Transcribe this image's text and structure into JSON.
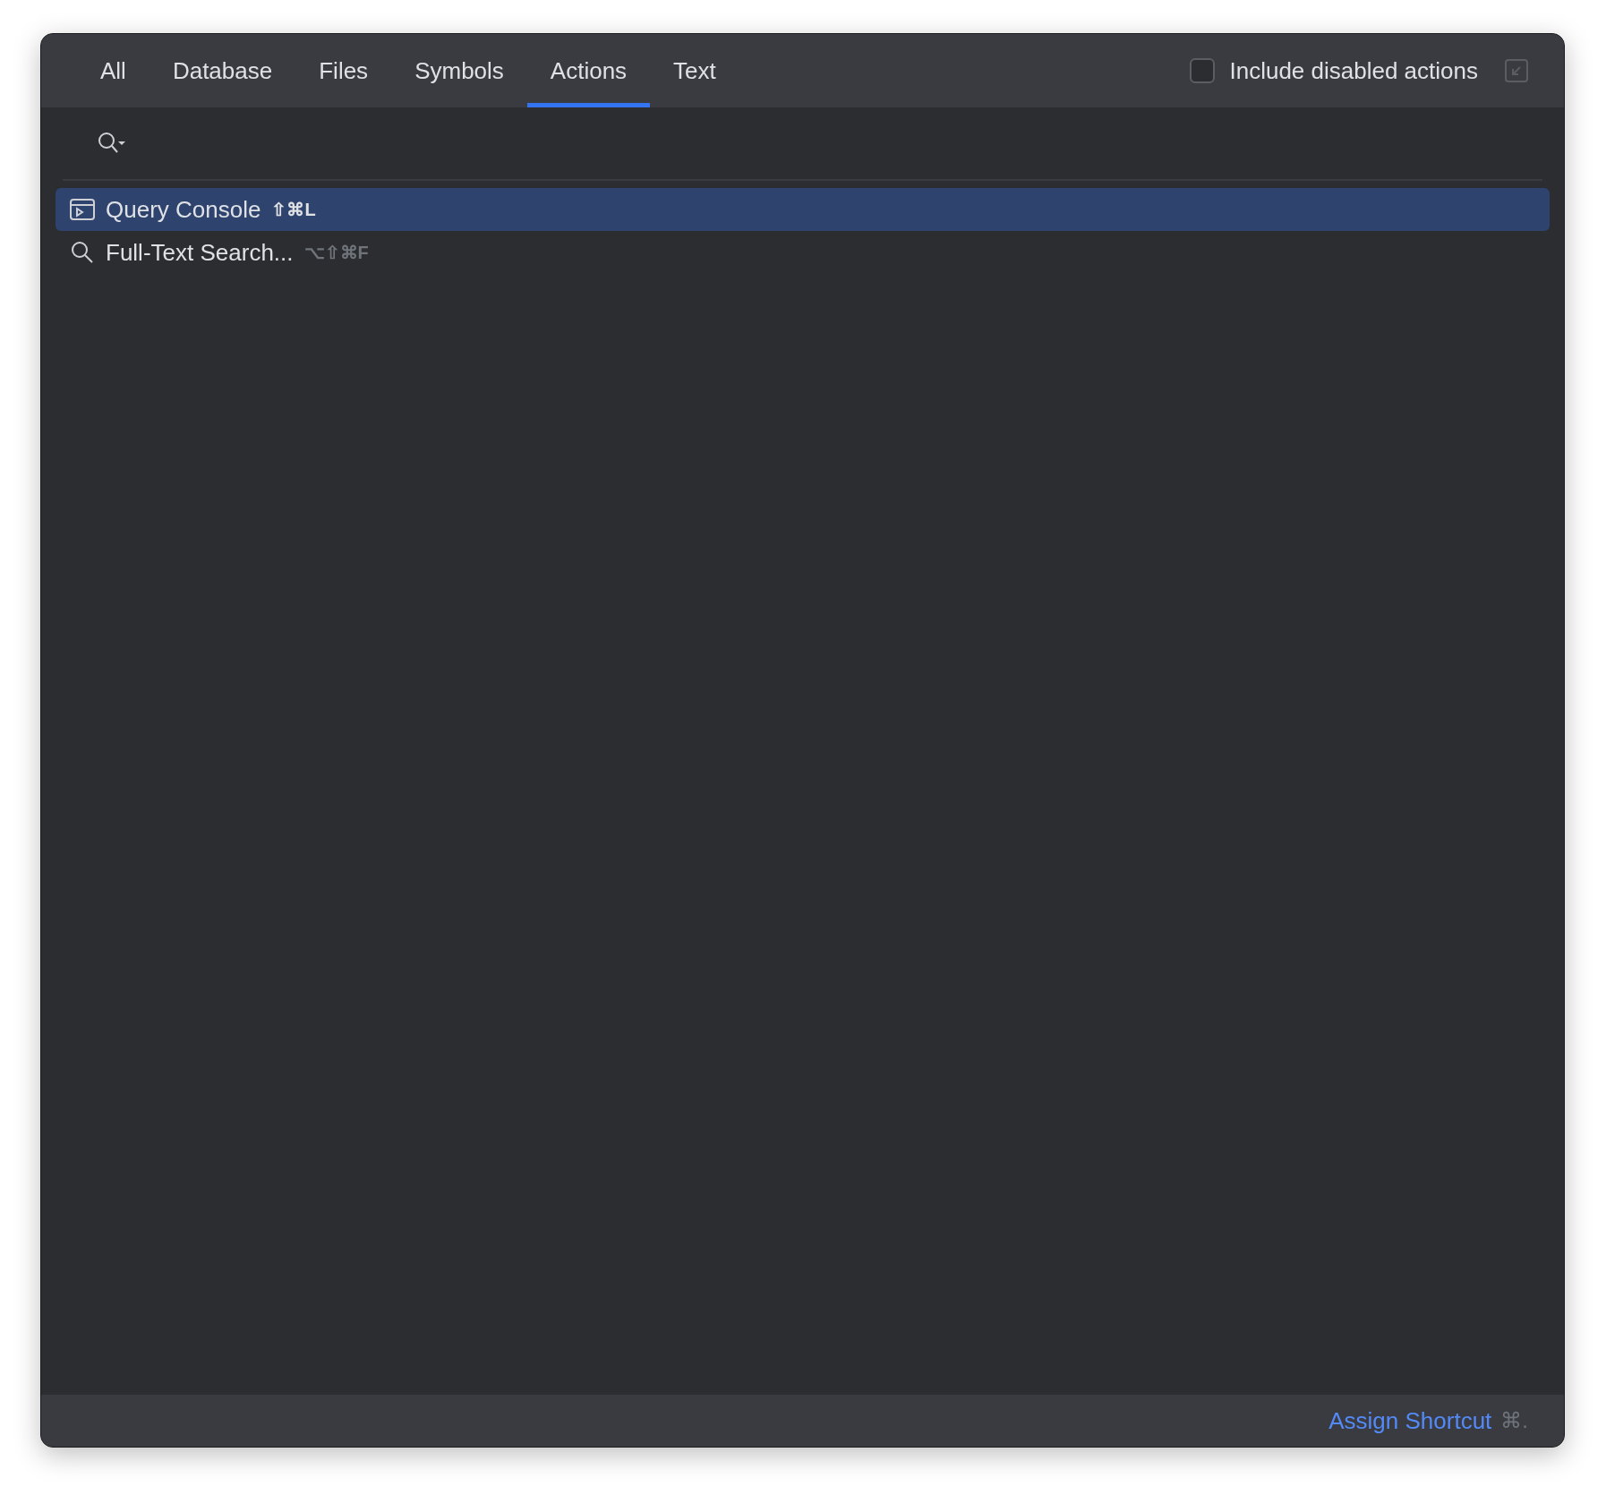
{
  "tabs": [
    {
      "label": "All",
      "selected": false
    },
    {
      "label": "Database",
      "selected": false
    },
    {
      "label": "Files",
      "selected": false
    },
    {
      "label": "Symbols",
      "selected": false
    },
    {
      "label": "Actions",
      "selected": true
    },
    {
      "label": "Text",
      "selected": false
    }
  ],
  "include_disabled": {
    "label": "Include disabled actions",
    "checked": false
  },
  "results": [
    {
      "kind": "console",
      "label": "Query Console",
      "shortcut": "⇧⌘L",
      "selected": true
    },
    {
      "kind": "search",
      "label": "Full-Text Search...",
      "shortcut": "⌥⇧⌘F",
      "selected": false
    }
  ],
  "footer": {
    "link": "Assign Shortcut",
    "shortcut": "⌘."
  }
}
